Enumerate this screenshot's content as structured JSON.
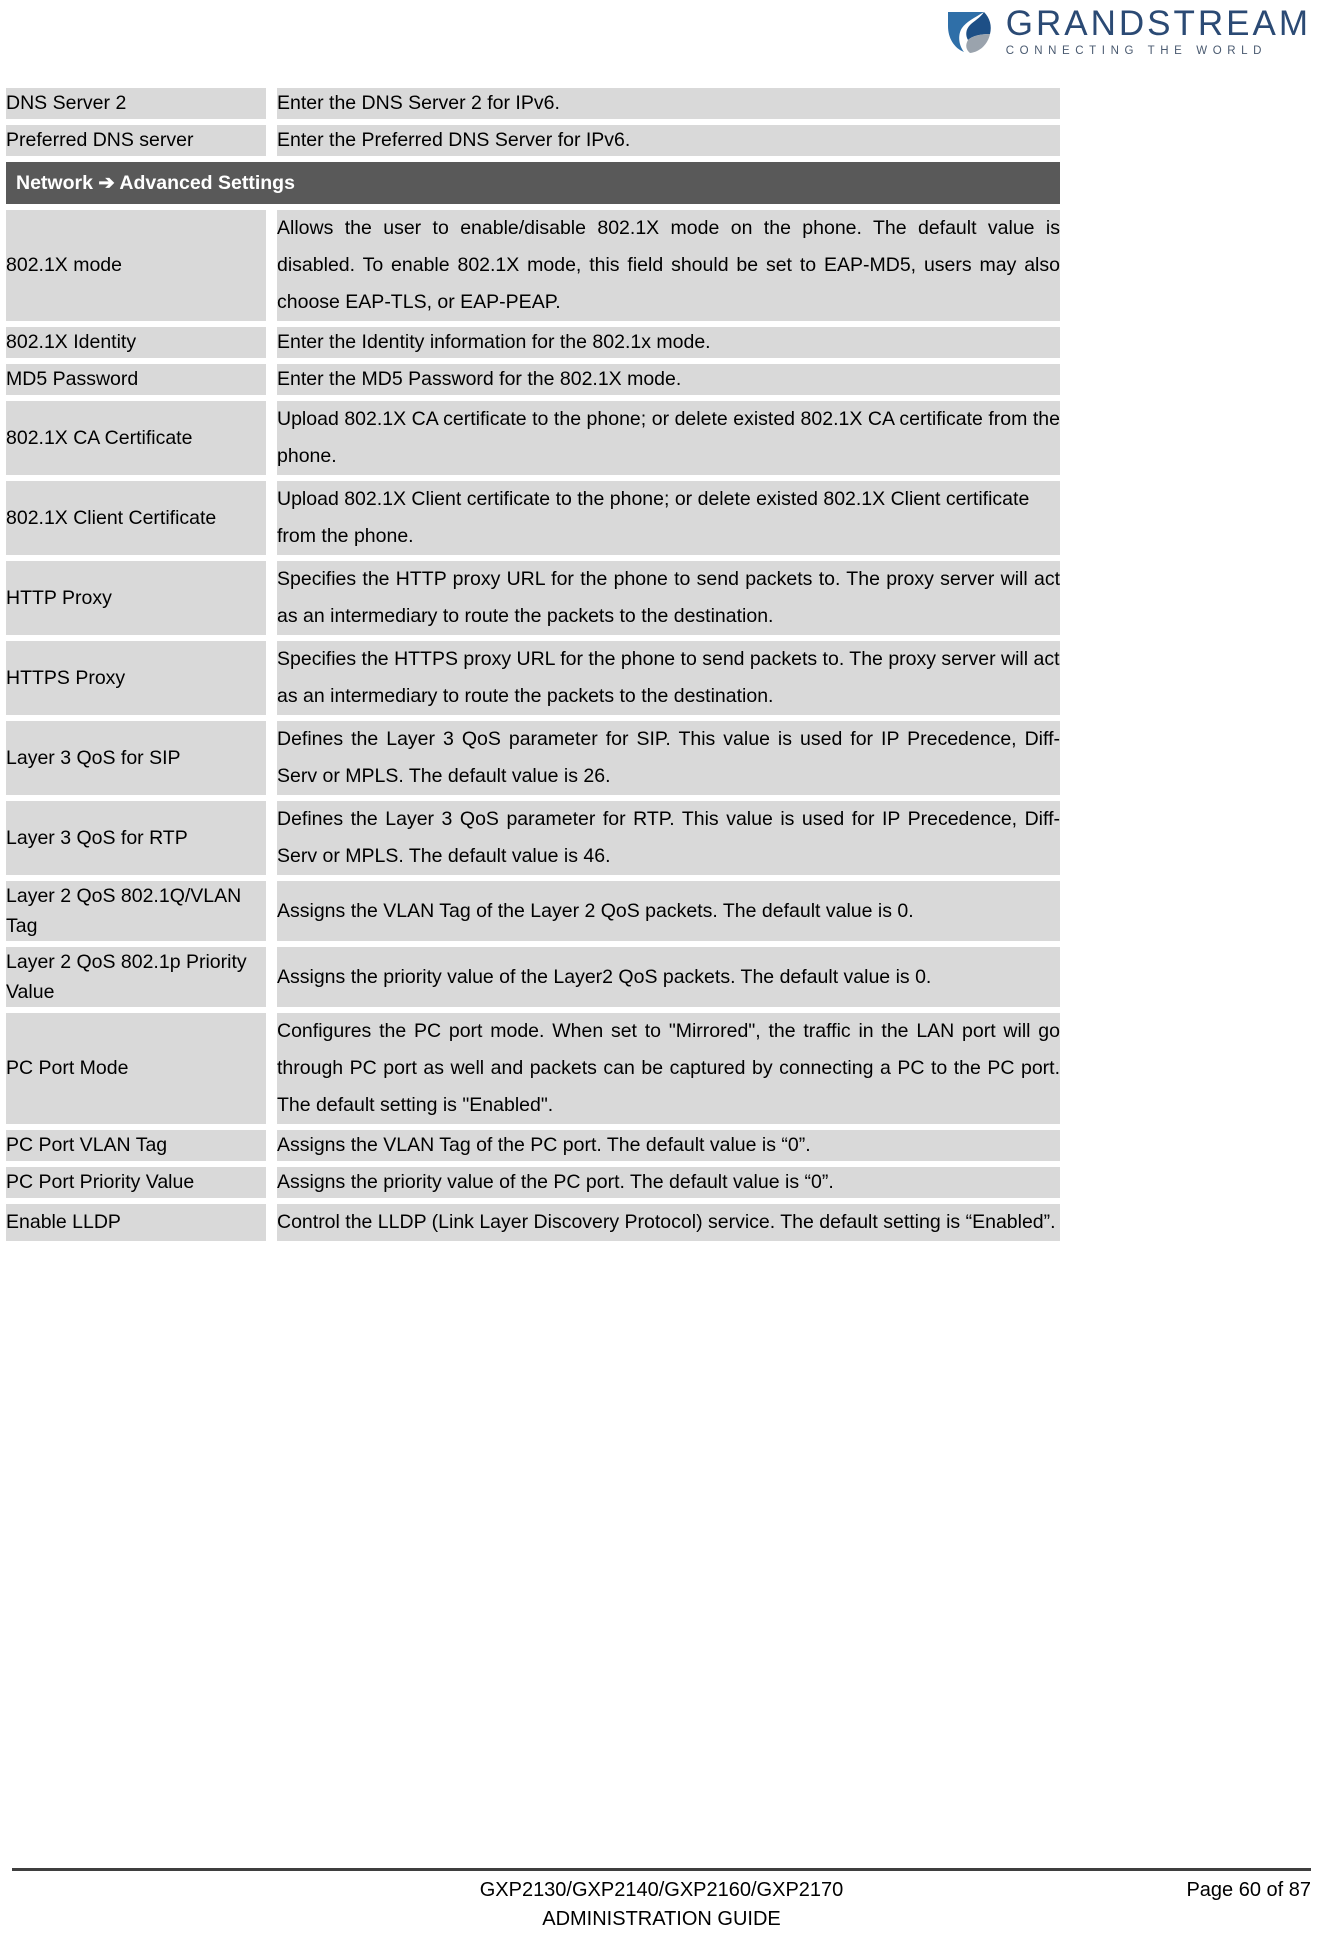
{
  "header": {
    "logo_name": "GRANDSTREAM",
    "logo_tagline": "CONNECTING THE WORLD",
    "brand_color": "#2b4a74"
  },
  "table": {
    "rows": [
      {
        "kind": "row",
        "label": "DNS Server 2",
        "desc": "Enter the DNS Server 2 for IPv6.",
        "lines": 1
      },
      {
        "kind": "row",
        "label": "Preferred DNS server",
        "desc": "Enter the Preferred DNS Server for IPv6.",
        "lines": 1
      },
      {
        "kind": "section",
        "label": "Network ➔ Advanced Settings"
      },
      {
        "kind": "row",
        "label": "802.1X mode",
        "desc": "Allows the user to enable/disable 802.1X mode on the phone. The default value is disabled. To enable 802.1X mode, this field should be set to EAP-MD5, users may also choose EAP-TLS, or EAP-PEAP.",
        "lines": 3
      },
      {
        "kind": "row",
        "label": "802.1X Identity",
        "desc": "Enter the Identity information for the 802.1x mode.",
        "lines": 1
      },
      {
        "kind": "row",
        "label": "MD5 Password",
        "desc": "Enter the MD5 Password for the 802.1X mode.",
        "lines": 1
      },
      {
        "kind": "row",
        "label": "802.1X CA Certificate",
        "desc": "Upload 802.1X CA certificate to the phone; or delete existed 802.1X CA certificate from the phone.",
        "lines": 2
      },
      {
        "kind": "row",
        "label": "802.1X Client Certificate",
        "desc": "Upload 802.1X Client certificate to the phone; or delete existed 802.1X Client certificate from the phone.",
        "lines": 2
      },
      {
        "kind": "row",
        "label": "HTTP Proxy",
        "desc": "Specifies the HTTP proxy URL for the phone to send packets to. The proxy server will act as an intermediary to route the packets to the destination.",
        "lines": 2
      },
      {
        "kind": "row",
        "label": "HTTPS Proxy",
        "desc": "Specifies the HTTPS proxy URL for the phone to send packets to. The proxy server will act as an intermediary to route the packets to the destination.",
        "lines": 2
      },
      {
        "kind": "row",
        "label": "Layer 3 QoS for SIP",
        "desc": "Defines the Layer 3 QoS parameter for SIP. This value is used for IP Precedence, Diff-Serv or MPLS. The default value is 26.",
        "lines": 2
      },
      {
        "kind": "row",
        "label": "Layer 3 QoS for RTP",
        "desc": "Defines the Layer 3 QoS parameter for RTP. This value is used for IP Precedence, Diff-Serv or MPLS. The default value is 46.",
        "lines": 2
      },
      {
        "kind": "row",
        "label": "Layer 2 QoS 802.1Q/VLAN Tag",
        "desc": "Assigns the VLAN Tag of the Layer 2 QoS packets. The default value is 0.",
        "lines": 1,
        "label_lines": 2
      },
      {
        "kind": "row",
        "label": "Layer 2 QoS 802.1p Priority Value",
        "desc": "Assigns the priority value of the Layer2 QoS packets. The default value is 0.",
        "lines": 1,
        "label_lines": 2
      },
      {
        "kind": "row",
        "label": "PC Port Mode",
        "desc": "Configures the PC port mode. When set to \"Mirrored\", the traffic in the LAN port will go through PC port as well and packets can be captured by connecting a PC to the PC port. The default setting is \"Enabled\".",
        "lines": 3
      },
      {
        "kind": "row",
        "label": "PC Port VLAN Tag",
        "desc": "Assigns the VLAN Tag of the PC port. The default value is “0”.",
        "lines": 1
      },
      {
        "kind": "row",
        "label": "PC Port Priority Value",
        "desc": "Assigns the priority value of the PC port. The default value is “0”.",
        "lines": 1
      },
      {
        "kind": "row",
        "label": "Enable LLDP",
        "desc": "Control the LLDP (Link Layer Discovery Protocol) service. The default setting is “Enabled”.",
        "lines": 2
      }
    ]
  },
  "footer": {
    "product_line": "GXP2130/GXP2140/GXP2160/GXP2170",
    "guide_line": "ADMINISTRATION GUIDE",
    "page_label": "Page 60 of 87"
  }
}
